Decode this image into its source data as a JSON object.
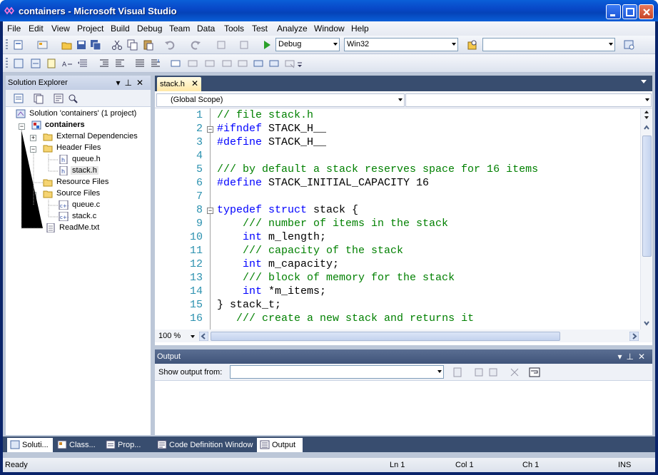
{
  "window": {
    "title": "containers - Microsoft Visual Studio",
    "controls": [
      "minimize",
      "maximize",
      "close"
    ]
  },
  "menu": [
    "File",
    "Edit",
    "View",
    "Project",
    "Build",
    "Debug",
    "Team",
    "Data",
    "Tools",
    "Test",
    "Analyze",
    "Window",
    "Help"
  ],
  "toolbar": {
    "configuration": "Debug",
    "platform": "Win32",
    "find_value": ""
  },
  "solution_explorer": {
    "title": "Solution Explorer",
    "items": [
      {
        "label": "Solution 'containers' (1 project)",
        "icon": "solution-icon"
      },
      {
        "label": "containers",
        "icon": "project-icon"
      },
      {
        "label": "External Dependencies",
        "icon": "folder-icon"
      },
      {
        "label": "Header Files",
        "icon": "folder-icon"
      },
      {
        "label": "queue.h",
        "icon": "header-file-icon"
      },
      {
        "label": "stack.h",
        "icon": "header-file-icon"
      },
      {
        "label": "Resource Files",
        "icon": "folder-icon"
      },
      {
        "label": "Source Files",
        "icon": "folder-icon"
      },
      {
        "label": "queue.c",
        "icon": "source-file-icon"
      },
      {
        "label": "stack.c",
        "icon": "source-file-icon"
      },
      {
        "label": "ReadMe.txt",
        "icon": "text-file-icon"
      }
    ]
  },
  "editor": {
    "tab": "stack.h",
    "scope": "(Global Scope)",
    "member": "",
    "zoom": "100 %",
    "lines": [
      {
        "n": "1",
        "parts": [
          [
            "cm",
            "// file stack.h"
          ]
        ]
      },
      {
        "n": "2",
        "parts": [
          [
            "kw",
            "#ifndef"
          ],
          [
            "tx",
            " STACK_H__"
          ]
        ]
      },
      {
        "n": "3",
        "parts": [
          [
            "kw",
            "#define"
          ],
          [
            "tx",
            " STACK_H__"
          ]
        ]
      },
      {
        "n": "4",
        "parts": []
      },
      {
        "n": "5",
        "parts": [
          [
            "cm",
            "/// by default a stack reserves space for 16 items"
          ]
        ]
      },
      {
        "n": "6",
        "parts": [
          [
            "kw",
            "#define"
          ],
          [
            "tx",
            " STACK_INITIAL_CAPACITY 16"
          ]
        ]
      },
      {
        "n": "7",
        "parts": []
      },
      {
        "n": "8",
        "parts": [
          [
            "kw",
            "typedef"
          ],
          [
            "tx",
            " "
          ],
          [
            "kw",
            "struct"
          ],
          [
            "tx",
            " stack {"
          ]
        ]
      },
      {
        "n": "9",
        "parts": [
          [
            "tx",
            "    "
          ],
          [
            "cm",
            "/// number of items in the stack"
          ]
        ]
      },
      {
        "n": "10",
        "parts": [
          [
            "tx",
            "    "
          ],
          [
            "kw",
            "int"
          ],
          [
            "tx",
            " m_length;"
          ]
        ]
      },
      {
        "n": "11",
        "parts": [
          [
            "tx",
            "    "
          ],
          [
            "cm",
            "/// capacity of the stack"
          ]
        ]
      },
      {
        "n": "12",
        "parts": [
          [
            "tx",
            "    "
          ],
          [
            "kw",
            "int"
          ],
          [
            "tx",
            " m_capacity;"
          ]
        ]
      },
      {
        "n": "13",
        "parts": [
          [
            "tx",
            "    "
          ],
          [
            "cm",
            "/// block of memory for the stack"
          ]
        ]
      },
      {
        "n": "14",
        "parts": [
          [
            "tx",
            "    "
          ],
          [
            "kw",
            "int"
          ],
          [
            "tx",
            " *m_items;"
          ]
        ]
      },
      {
        "n": "15",
        "parts": [
          [
            "tx",
            "} stack_t;"
          ]
        ]
      },
      {
        "n": "16",
        "parts": [
          [
            "tx",
            "   "
          ],
          [
            "cm",
            "/// create a new stack and returns it"
          ]
        ]
      }
    ]
  },
  "output": {
    "title": "Output",
    "show_output_label": "Show output from:",
    "source_value": ""
  },
  "bottom_tabs": [
    "Soluti...",
    "Class...",
    "Prop...",
    "Code Definition Window",
    "Output"
  ],
  "status": {
    "message": "Ready",
    "line": "Ln 1",
    "col": "Col 1",
    "ch": "Ch 1",
    "mode": "INS"
  }
}
